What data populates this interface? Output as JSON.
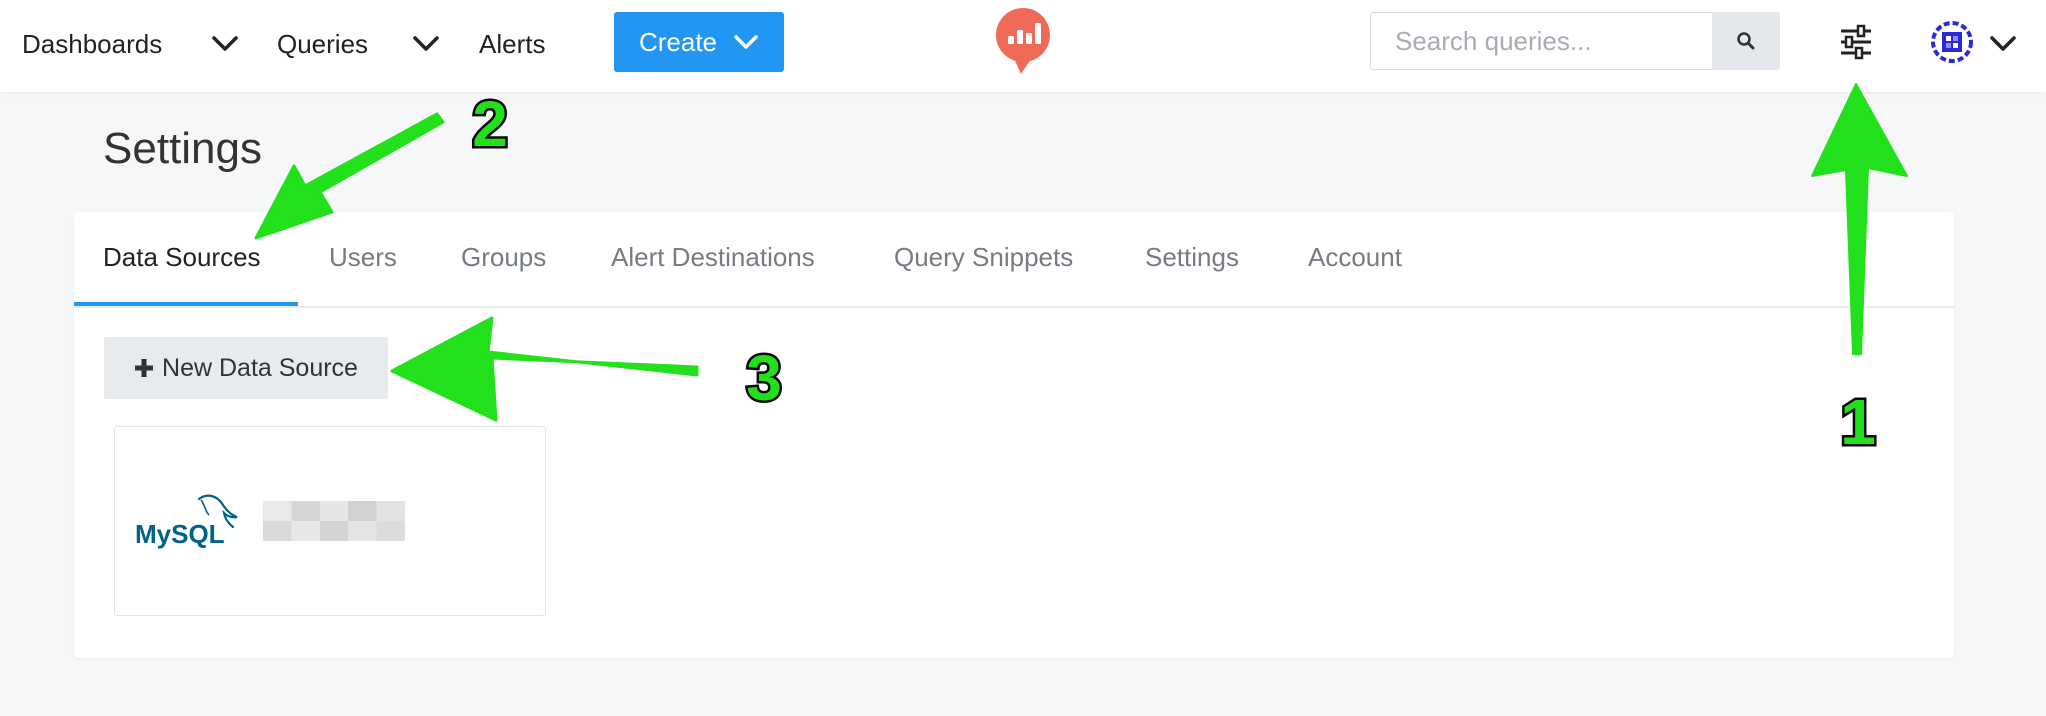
{
  "nav": {
    "items": [
      {
        "label": "Dashboards",
        "has_dropdown": true
      },
      {
        "label": "Queries",
        "has_dropdown": true
      },
      {
        "label": "Alerts",
        "has_dropdown": false
      }
    ],
    "create_label": "Create",
    "search_placeholder": "Search queries...",
    "icons": [
      "chevron-down-icon",
      "redash-logo",
      "search-icon",
      "settings-sliders-icon",
      "user-avatar"
    ]
  },
  "page": {
    "title": "Settings",
    "tabs": [
      {
        "label": "Data Sources",
        "active": true
      },
      {
        "label": "Users",
        "active": false
      },
      {
        "label": "Groups",
        "active": false
      },
      {
        "label": "Alert Destinations",
        "active": false
      },
      {
        "label": "Query Snippets",
        "active": false
      },
      {
        "label": "Settings",
        "active": false
      },
      {
        "label": "Account",
        "active": false
      }
    ],
    "new_data_source_label": "New Data Source",
    "data_sources": [
      {
        "logo_text": "MySQL",
        "name_redacted": true
      }
    ]
  },
  "annotations": {
    "markers": [
      "1",
      "2",
      "3"
    ],
    "arrow_color": "#22e01b",
    "outline_color": "#0a0a0a"
  },
  "colors": {
    "accent": "#2196f3",
    "logo": "#f06b57",
    "mysql_blue": "#00618a",
    "mysql_orange": "#e48e00"
  }
}
